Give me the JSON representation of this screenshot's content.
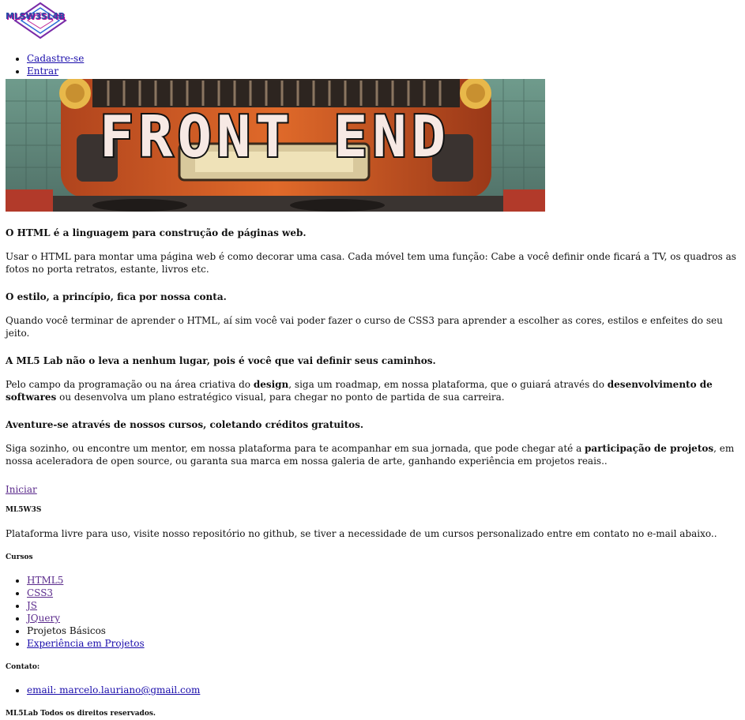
{
  "header": {
    "logo_text": "MLSW3SL4B",
    "nav": [
      "Cadastre-se",
      "Entrar"
    ]
  },
  "hero": {
    "title": "FRONT END"
  },
  "sections": [
    {
      "heading": "O HTML é a linguagem para construção de páginas web.",
      "text": "Usar o HTML para montar uma página web é como decorar uma casa. Cada móvel tem uma função: Cabe a você definir onde ficará a TV, os quadros as fotos no porta retratos, estante, livros etc."
    },
    {
      "heading": "O estilo, a princípio, fica por nossa conta.",
      "text": "Quando você terminar de aprender o HTML, aí sim você vai poder fazer o curso de CSS3 para aprender a escolher as cores, estilos e enfeites do seu jeito."
    },
    {
      "heading": "A ML5 Lab não o leva a nenhum lugar, pois é você que vai definir seus caminhos.",
      "text_parts": [
        "Pelo campo da programação ou na área criativa do ",
        "design",
        ", siga um roadmap, em nossa plataforma, que o guiará através do ",
        "desenvolvimento de softwares",
        " ou desenvolva um plano estratégico visual, para chegar no ponto de partida de sua carreira."
      ]
    },
    {
      "heading": "Aventure-se através de nossos cursos, coletando créditos gratuitos.",
      "text_parts": [
        "Siga sozinho, ou encontre um mentor, em nossa plataforma para te acompanhar em sua jornada, que pode chegar até a ",
        "participação de projetos",
        ", em nossa aceleradora de open source, ou garanta sua marca em nossa galeria de arte, ganhando experiência em projetos reais.."
      ]
    }
  ],
  "cta": "Iniciar",
  "footer": {
    "brand": "ML5W3S",
    "about": "Plataforma livre para uso, visite nosso repositório no github, se tiver a necessidade de um cursos personalizado entre em contato no e-mail abaixo..",
    "courses_heading": "Cursos",
    "courses": [
      {
        "label": "HTML5",
        "link": true
      },
      {
        "label": "CSS3",
        "link": true
      },
      {
        "label": "JS",
        "link": true
      },
      {
        "label": "JQuery",
        "link": true
      },
      {
        "label": "Projetos Básicos",
        "link": false
      },
      {
        "label": "Experiência em Projetos",
        "link": true
      }
    ],
    "contact_heading": "Contato:",
    "contact_email": "email: marcelo.lauriano@gmail.com",
    "rights": "ML5Lab Todos os direitos reservados."
  },
  "colors": {
    "link": "#1a0dab",
    "visited": "#5b2b8c"
  }
}
